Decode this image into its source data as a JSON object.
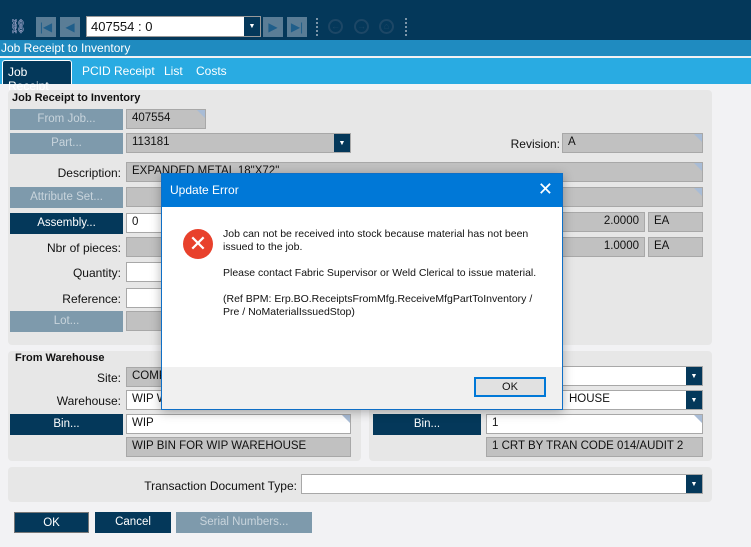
{
  "toolbar": {
    "record": "407554 : 0"
  },
  "window_title": "Job Receipt to Inventory",
  "tabs": [
    "Job Receipt",
    "PCID Receipt",
    "List",
    "Costs"
  ],
  "main": {
    "section_title": "Job Receipt to Inventory",
    "from_job_button": "From Job...",
    "from_job": "407554",
    "part_button": "Part...",
    "part": "113181",
    "revision_label": "Revision:",
    "revision": "A",
    "description_label": "Description:",
    "description": "EXPANDED METAL 18\"X72\"",
    "attribute_button": "Attribute Set...",
    "assembly_button": "Assembly...",
    "assembly": "0",
    "assembly_qty": "2.0000",
    "assembly_uom": "EA",
    "pieces_label": "Nbr of pieces:",
    "pieces_qty": "1.0000",
    "pieces_uom": "EA",
    "quantity_label": "Quantity:",
    "reference_label": "Reference:",
    "lot_button": "Lot..."
  },
  "from_wh": {
    "title": "From Warehouse",
    "site_label": "Site:",
    "site": "COMP",
    "warehouse_label": "Warehouse:",
    "warehouse": "WIP W",
    "bin_button": "Bin...",
    "bin": "WIP",
    "bin_desc": "WIP BIN FOR WIP WAREHOUSE"
  },
  "to_wh": {
    "warehouse": "HOUSE",
    "bin_button": "Bin...",
    "bin": "1",
    "bin_desc": "1 CRT BY TRAN CODE 014/AUDIT 2"
  },
  "trans_doc_label": "Transaction Document Type:",
  "buttons": {
    "ok": "OK",
    "cancel": "Cancel",
    "serial": "Serial Numbers..."
  },
  "dialog": {
    "title": "Update Error",
    "close": "✕",
    "icon": "error-icon",
    "lines": [
      "Job can not be received into stock because material has not been issued to the job.",
      "Please contact Fabric Supervisor or Weld Clerical to issue material.",
      "(Ref BPM: Erp.BO.ReceiptsFromMfg.ReceiveMfgPartToInventory / Pre / NoMaterialIssuedStop)"
    ],
    "ok": "OK"
  }
}
